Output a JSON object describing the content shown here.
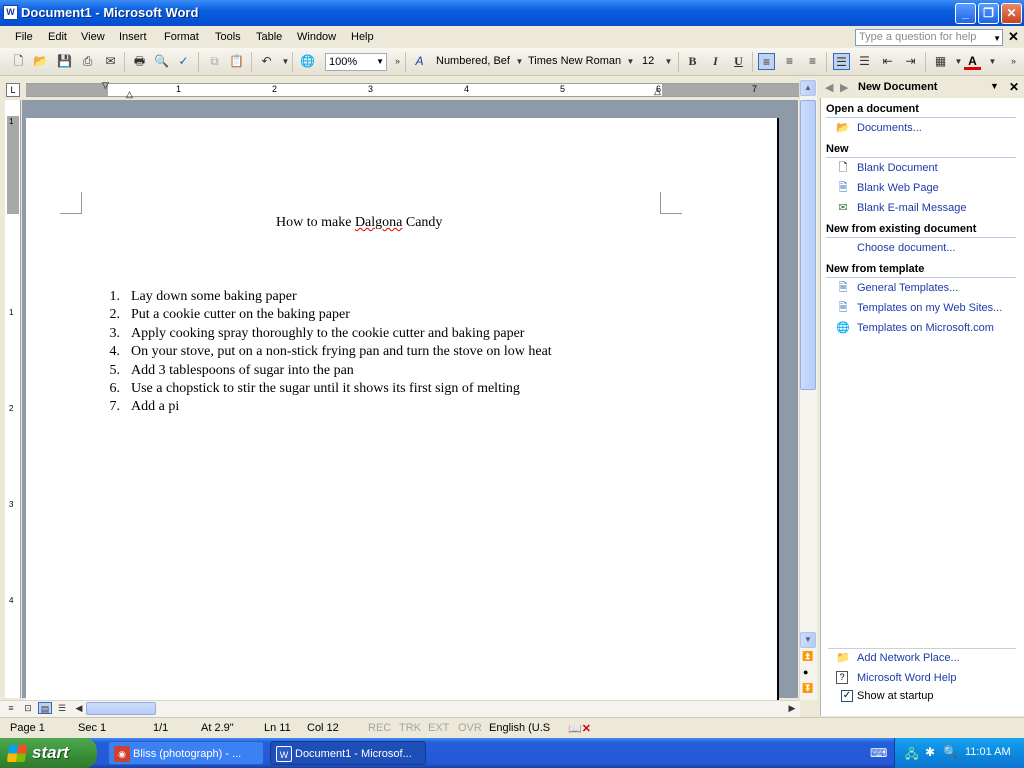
{
  "window": {
    "title": "Document1 - Microsoft Word",
    "icon": "word-app-icon"
  },
  "menu": {
    "items": [
      "File",
      "Edit",
      "View",
      "Insert",
      "Format",
      "Tools",
      "Table",
      "Window",
      "Help"
    ],
    "help_placeholder": "Type a question for help"
  },
  "toolbar": {
    "zoom": "100%",
    "style": "Numbered, Bef",
    "font": "Times New Roman",
    "size": "12"
  },
  "ruler": {
    "numbers": [
      "1",
      "2",
      "3",
      "4",
      "5",
      "6",
      "7"
    ],
    "vertical_numbers": [
      "1",
      "1",
      "2",
      "3",
      "4"
    ]
  },
  "document": {
    "title_pre": "How to make ",
    "title_word": "Dalgona",
    "title_post": " Candy",
    "items": [
      {
        "n": "1.",
        "text": "Lay down some baking paper"
      },
      {
        "n": "2.",
        "text": "Put a cookie cutter on the baking paper"
      },
      {
        "n": "3.",
        "text": "Apply cooking spray thoroughly to the cookie cutter and baking paper"
      },
      {
        "n": "4.",
        "text": "On your stove, put on a non-stick frying pan and turn the stove on low heat"
      },
      {
        "n": "5.",
        "text": "Add 3 tablespoons of sugar into the pan"
      },
      {
        "n": "6.",
        "text": "Use a chopstick to stir the sugar until it shows its first sign of melting"
      },
      {
        "n": "7.",
        "text": "Add a pi"
      }
    ]
  },
  "taskpane": {
    "title": "New Document",
    "open_heading": "Open a document",
    "documents_link": "Documents...",
    "new_heading": "New",
    "blank_document": "Blank Document",
    "blank_web_page": "Blank Web Page",
    "blank_email": "Blank E-mail Message",
    "existing_heading": "New from existing document",
    "choose_document": "Choose document...",
    "template_heading": "New from template",
    "general_templates": "General Templates...",
    "templates_web_sites": "Templates on my Web Sites...",
    "templates_microsoft": "Templates on Microsoft.com",
    "add_network_place": "Add Network Place...",
    "word_help": "Microsoft Word Help",
    "show_at_startup": "Show at startup"
  },
  "status": {
    "page": "Page  1",
    "sec": "Sec  1",
    "pages": "1/1",
    "at": "At  2.9\"",
    "ln": "Ln  11",
    "col": "Col  12",
    "rec": "REC",
    "trk": "TRK",
    "ext": "EXT",
    "ovr": "OVR",
    "language": "English (U.S"
  },
  "taskbar": {
    "start": "start",
    "task1": "Bliss (photograph) - ...",
    "task2": "Document1 - Microsof...",
    "clock": "11:01 AM"
  },
  "colors": {
    "title_blue": "#0a5fe0",
    "link_blue": "#1d3ba8",
    "start_green": "#378e37",
    "spell_red": "#e00000"
  }
}
